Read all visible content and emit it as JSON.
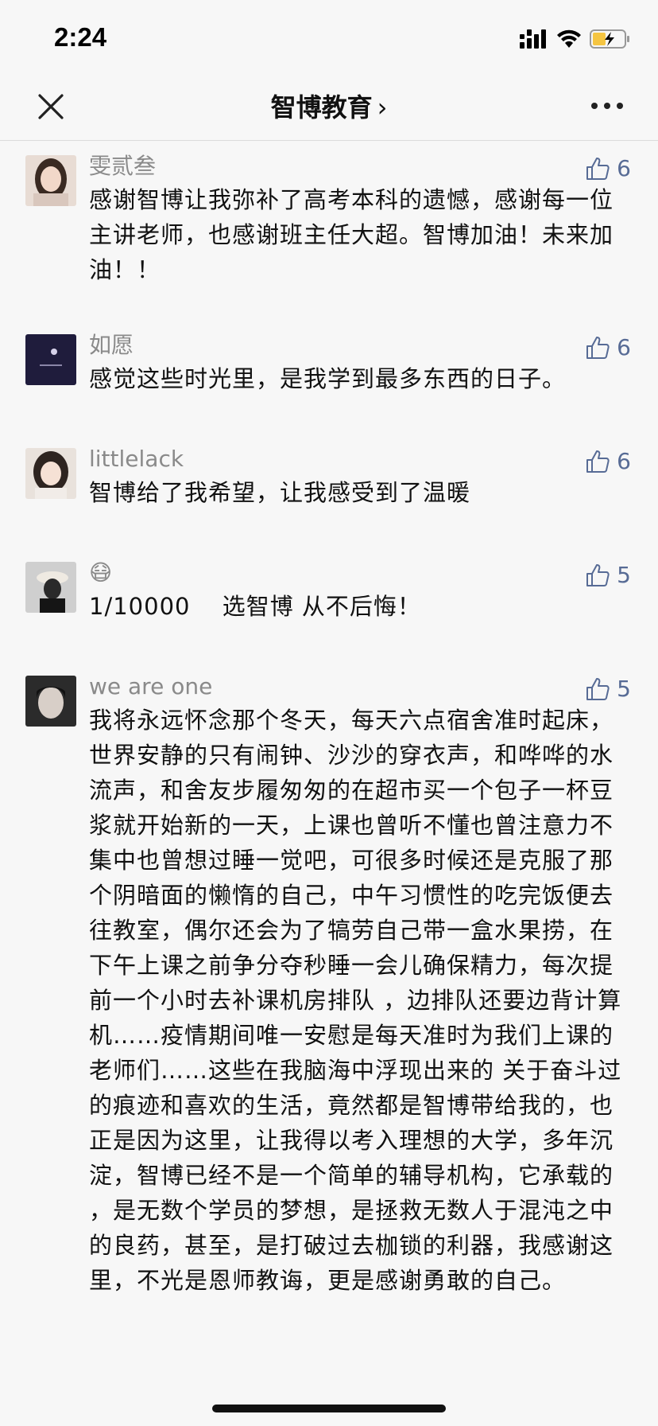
{
  "status": {
    "time": "2:24",
    "battery_color": "#f5c542"
  },
  "navbar": {
    "title": "智博教育",
    "chevron": "›"
  },
  "comments": [
    {
      "name": "雯贰叁",
      "likes": "6",
      "text": "感谢智博让我弥补了高考本科的遗憾，感谢每一位主讲老师，也感谢班主任大超。智博加油！未来加油！！",
      "avatar_icon": "girl-portrait-avatar"
    },
    {
      "name": "如愿",
      "likes": "6",
      "text": "感觉这些时光里，是我学到最多东西的日子。",
      "avatar_icon": "night-sky-avatar"
    },
    {
      "name": "littlelack",
      "likes": "6",
      "text": "智博给了我希望，让我感受到了温暖",
      "avatar_icon": "girl-selfie-avatar"
    },
    {
      "name": "😷",
      "likes": "5",
      "text": "1/10000　 选智博 从不后悔！",
      "avatar_icon": "hat-photo-avatar"
    },
    {
      "name": "we are one",
      "likes": "5",
      "text": "我将永远怀念那个冬天，每天六点宿舍准时起床，世界安静的只有闹钟、沙沙的穿衣声，和哗哗的水流声，和舍友步履匆匆的在超市买一个包子一杯豆浆就开始新的一天，上课也曾听不懂也曾注意力不集中也曾想过睡一觉吧，可很多时候还是克服了那个阴暗面的懒惰的自己，中午习惯性的吃完饭便去往教室，偶尔还会为了犒劳自己带一盒水果捞，在下午上课之前争分夺秒睡一会儿确保精力，每次提前一个小时去补课机房排队 ，边排队还要边背计算机……疫情期间唯一安慰是每天准时为我们上课的老师们……这些在我脑海中浮现出来的 关于奋斗过的痕迹和喜欢的生活，竟然都是智博带给我的，也正是因为这里，让我得以考入理想的大学，多年沉淀，智博已经不是一个简单的辅导机构，它承载的 ，是无数个学员的梦想，是拯救无数人于混沌之中的良药，甚至，是打破过去枷锁的利器，我感谢这里，不光是恩师教诲，更是感谢勇敢的自己。",
      "avatar_icon": "girl-dark-portrait-avatar"
    }
  ],
  "colors": {
    "like_blue": "#576b95",
    "name_gray": "#8a8a8a",
    "background": "#f7f7f7"
  }
}
